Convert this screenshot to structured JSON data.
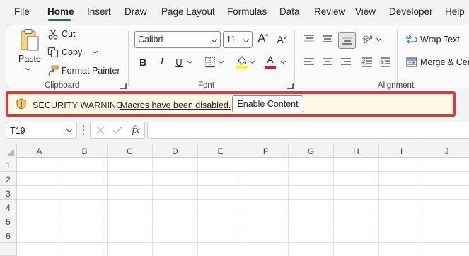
{
  "menu": {
    "tabs": [
      "File",
      "Home",
      "Insert",
      "Draw",
      "Page Layout",
      "Formulas",
      "Data",
      "Review",
      "View",
      "Developer",
      "Help"
    ],
    "active_tab": "Home"
  },
  "clipboard": {
    "paste_label": "Paste",
    "cut_label": "Cut",
    "copy_label": "Copy",
    "format_painter_label": "Format Painter",
    "group_label": "Clipboard"
  },
  "font": {
    "family_value": "Calibri",
    "size_value": "11",
    "grow_label": "A",
    "shrink_label": "A",
    "bold_label": "B",
    "italic_label": "I",
    "underline_label": "U",
    "font_color_label": "A",
    "group_label": "Font"
  },
  "alignment": {
    "wrap_text_label": "Wrap Text",
    "merge_label": "Merge & Center",
    "group_label": "Alignment"
  },
  "security": {
    "title": "SECURITY WARNING",
    "message": "Macros have been disabled.",
    "button_label": "Enable Content"
  },
  "formula_bar": {
    "name_box_value": "T19",
    "fx_label": "fx",
    "formula_value": ""
  },
  "grid": {
    "columns": [
      "A",
      "B",
      "C",
      "D",
      "E",
      "F",
      "G",
      "H",
      "I",
      "J"
    ],
    "rows": [
      "1",
      "2",
      "3",
      "4",
      "5",
      "6"
    ]
  },
  "colors": {
    "accent": "#1e7145",
    "warning_border": "#d83b3f",
    "warning_background": "#fff9e6",
    "fill_highlight": "#ffff00",
    "font_color_red": "#e81123"
  }
}
